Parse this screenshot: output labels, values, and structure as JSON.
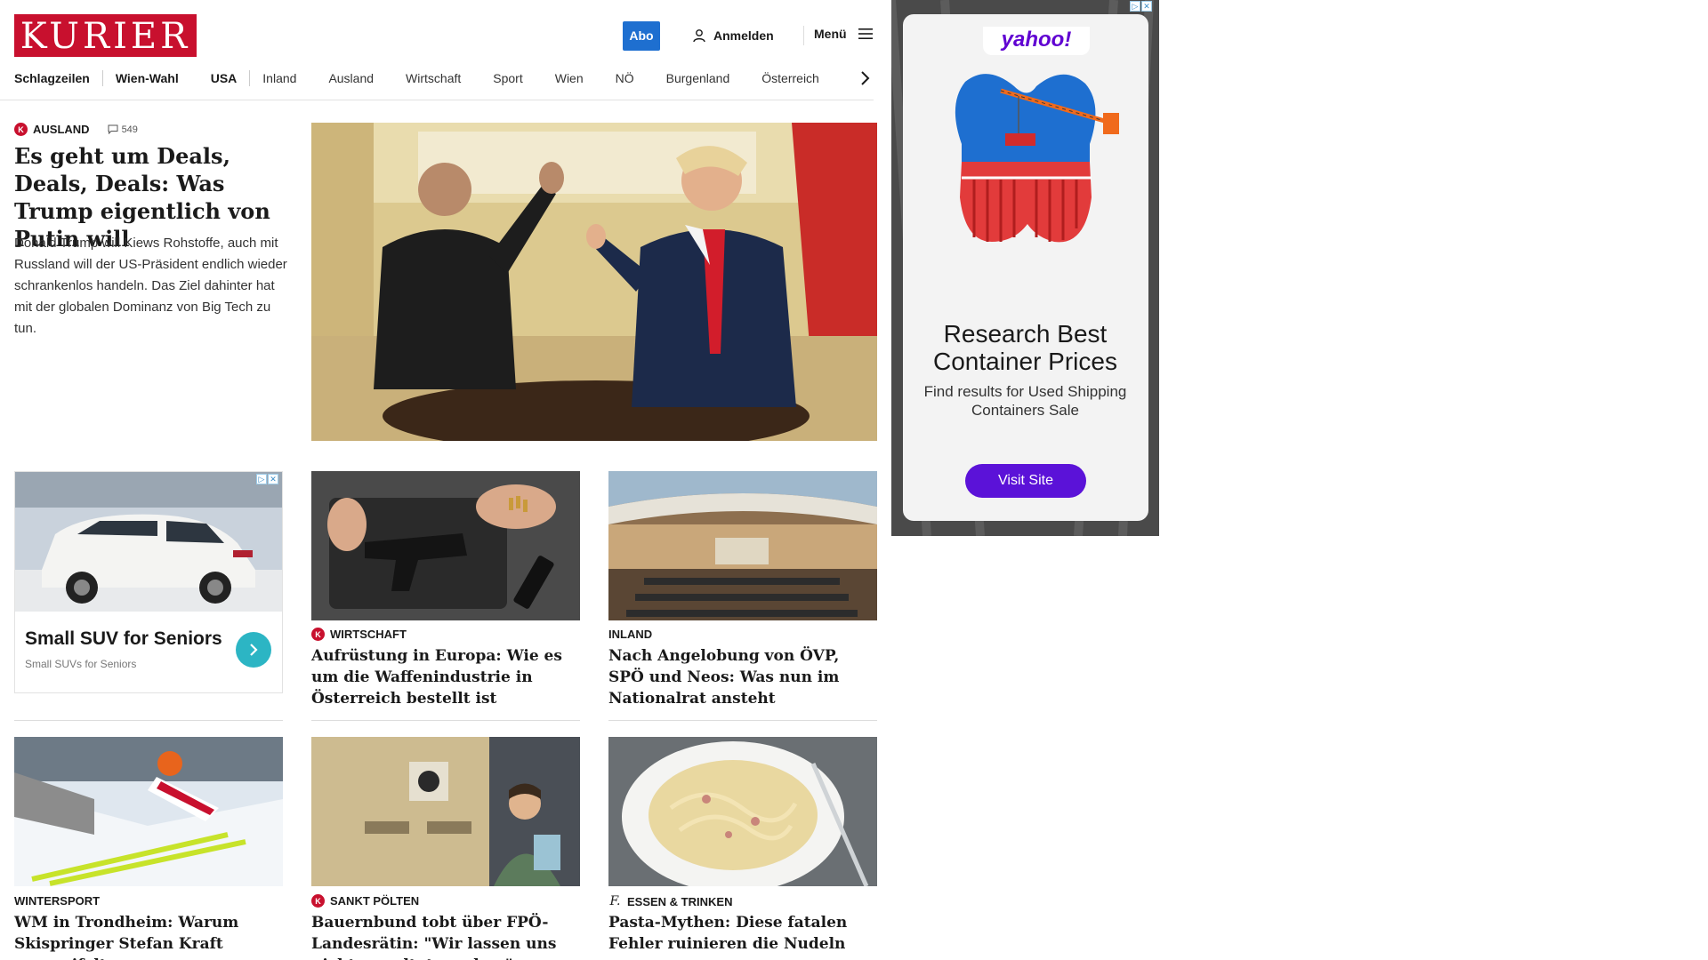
{
  "header": {
    "logo": "KURIER",
    "abo_label": "Abo",
    "login_label": "Anmelden",
    "menu_label": "Menü"
  },
  "nav": {
    "items": [
      "Schlagzeilen",
      "Wien-Wahl",
      "USA",
      "Inland",
      "Ausland",
      "Wirtschaft",
      "Sport",
      "Wien",
      "NÖ",
      "Burgenland",
      "Österreich"
    ]
  },
  "lead": {
    "kicker": "AUSLAND",
    "comments": "549",
    "title": "Es geht um Deals, Deals, Deals: Was Trump eigentlich von Putin will",
    "text": "Donald Trump will Kiews Rohstoffe, auch mit Russland will der US-Präsident endlich wieder schrankenlos handeln. Das Ziel dahinter hat mit der globalen Dominanz von Big Tech zu tun."
  },
  "ad_card": {
    "title": "Small SUV for Seniors",
    "subtitle": "Small SUVs for Seniors"
  },
  "cards": [
    {
      "kicker": "WIRTSCHAFT",
      "premium": true,
      "title": "Aufrüstung in Europa: Wie es um die Waffenindustrie in Österreich bestellt ist"
    },
    {
      "kicker": "INLAND",
      "premium": false,
      "title": "Nach Angelobung von ÖVP, SPÖ und Neos: Was nun im Nationalrat ansteht"
    },
    {
      "kicker": "WINTERSPORT",
      "premium": false,
      "title": "WM in Trondheim: Warum Skispringer Stefan Kraft verzweifelt"
    },
    {
      "kicker": "SANKT PÖLTEN",
      "premium": true,
      "title": "Bauernbund tobt über FPÖ-Landesrätin: \"Wir lassen uns nicht mundtot machen\""
    },
    {
      "kicker": "ESSEN & TRINKEN",
      "premium": false,
      "title": "Pasta-Mythen: Diese fatalen Fehler ruinieren die Nudeln"
    }
  ],
  "side_ad": {
    "brand": "yahoo!",
    "headline": "Research Best Container Prices",
    "text": "Find results for Used Shipping Containers Sale",
    "button": "Visit Site"
  },
  "colors": {
    "brand_red": "#c8102e",
    "abo_blue": "#1e6fd0",
    "yahoo_purple": "#5b12d8",
    "ad_teal": "#2cb5c4"
  }
}
